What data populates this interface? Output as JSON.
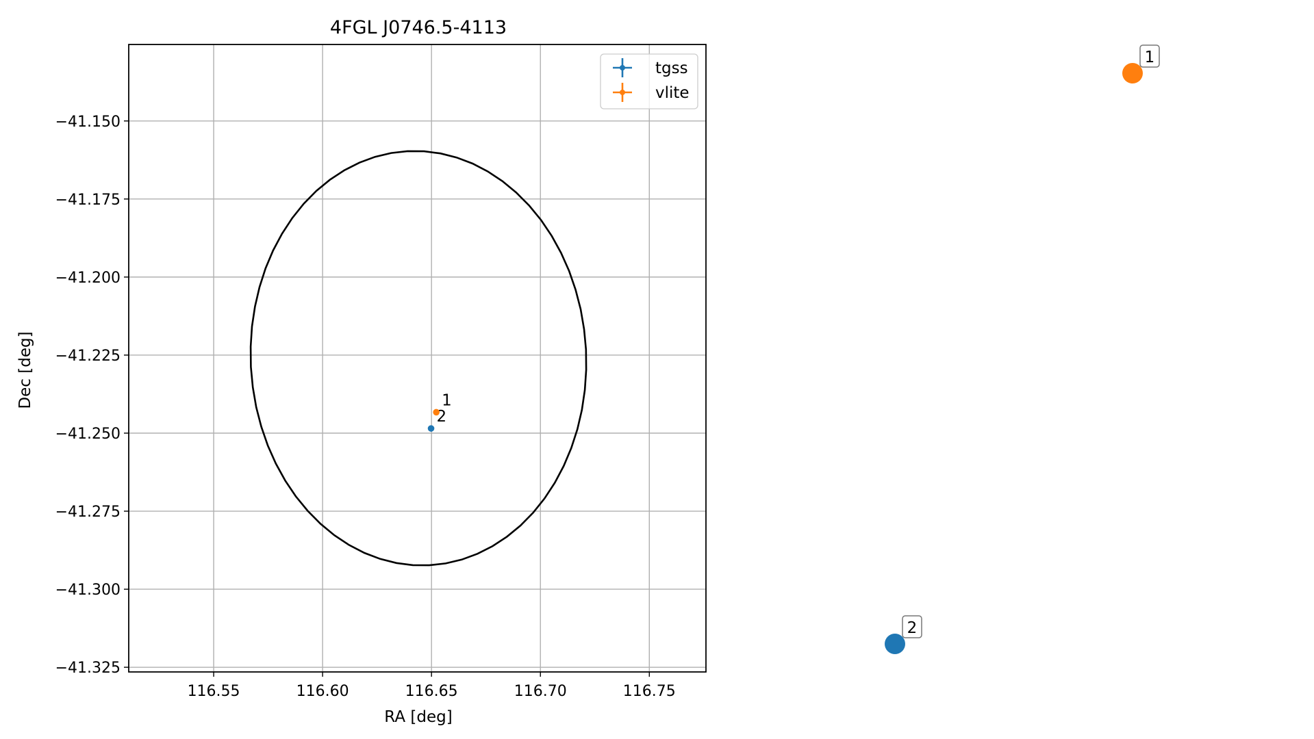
{
  "chart_data": {
    "type": "scatter",
    "title": "4FGL J0746.5-4113",
    "xlabel": "RA [deg]",
    "ylabel": "Dec [deg]",
    "xlim": [
      116.511,
      116.776
    ],
    "ylim": [
      -41.3265,
      -41.1255
    ],
    "xticks": [
      "116.55",
      "116.60",
      "116.65",
      "116.70",
      "116.75"
    ],
    "xtick_values": [
      116.55,
      116.6,
      116.65,
      116.7,
      116.75
    ],
    "yticks": [
      "−41.150",
      "−41.175",
      "−41.200",
      "−41.225",
      "−41.250",
      "−41.275",
      "−41.300",
      "−41.325"
    ],
    "ytick_values": [
      -41.15,
      -41.175,
      -41.2,
      -41.225,
      -41.25,
      -41.275,
      -41.3,
      -41.325
    ],
    "grid": true,
    "legend_position": "top-right",
    "series": [
      {
        "name": "tgss",
        "color": "#1f77b4",
        "points": [
          {
            "x": 116.6498,
            "y": -41.2485,
            "label": "2"
          }
        ]
      },
      {
        "name": "vlite",
        "color": "#ff7f0e",
        "points": [
          {
            "x": 116.6522,
            "y": -41.2433,
            "label": "1"
          }
        ]
      }
    ],
    "ellipse": {
      "center_x": 116.644,
      "center_y": -41.226,
      "color": "#000000"
    },
    "side_markers": [
      {
        "label": "1",
        "color": "#ff7f0e"
      },
      {
        "label": "2",
        "color": "#1f77b4"
      }
    ]
  }
}
